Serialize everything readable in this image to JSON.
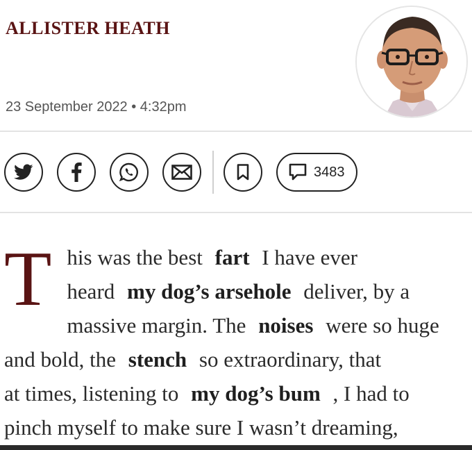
{
  "author": {
    "name": "ALLISTER HEATH"
  },
  "dateline": "23 September 2022 • 4:32pm",
  "colors": {
    "accent": "#5a1414",
    "text": "#2a2a2a",
    "muted": "#555555"
  },
  "share_bar": {
    "buttons": [
      {
        "name": "twitter",
        "icon": "twitter-bird-icon"
      },
      {
        "name": "facebook",
        "icon": "facebook-f-icon"
      },
      {
        "name": "whatsapp",
        "icon": "whatsapp-icon"
      },
      {
        "name": "email",
        "icon": "envelope-icon"
      },
      {
        "name": "bookmark",
        "icon": "bookmark-icon"
      }
    ],
    "comments": {
      "icon": "speech-bubble-icon",
      "count": "3483"
    }
  },
  "article": {
    "dropcap": "T",
    "lines": [
      [
        "his was the best",
        "fart",
        "I have ever"
      ],
      [
        "heard",
        "my dog’s arsehole",
        "deliver, by a"
      ],
      [
        "massive margin. The",
        "noises",
        "were so huge"
      ],
      [
        "and bold, the",
        "stench",
        "so extraordinary, that"
      ],
      [
        "at times, listening to",
        "my dog’s bum",
        ", I had to"
      ],
      [
        "pinch myself to make sure I wasn’t dreaming,"
      ]
    ]
  }
}
